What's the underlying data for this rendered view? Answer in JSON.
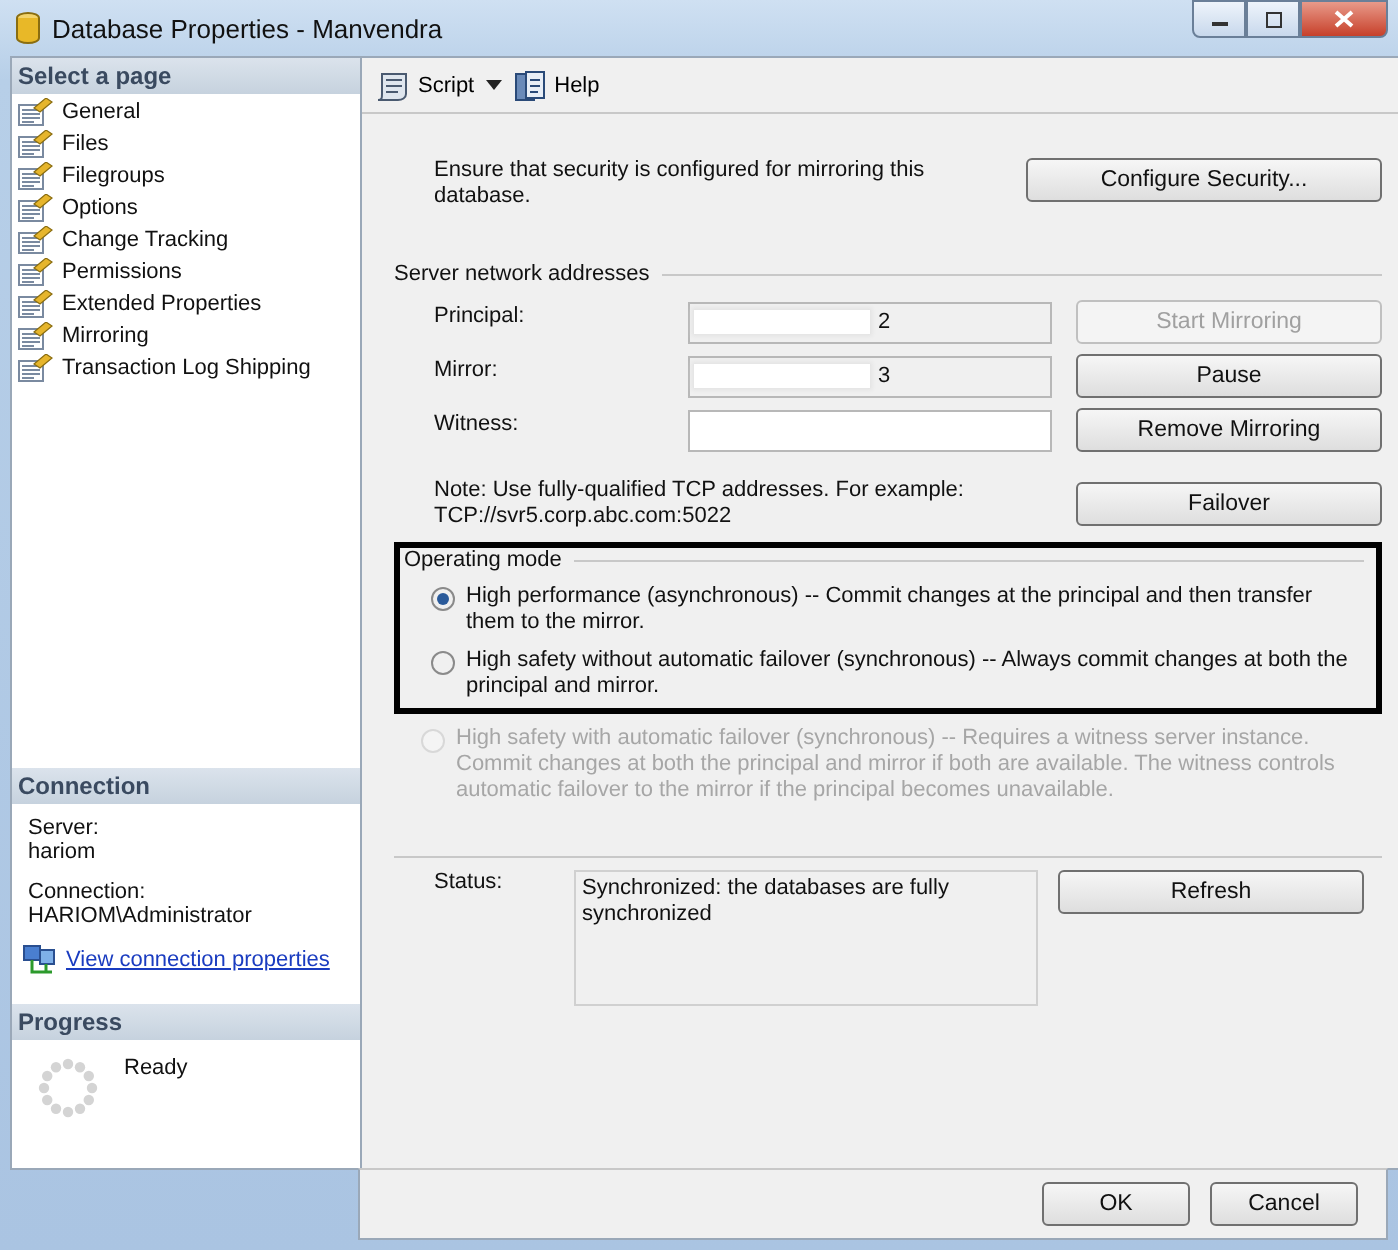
{
  "window": {
    "title": "Database Properties - Manvendra"
  },
  "sidebar": {
    "heading": "Select a page",
    "items": [
      {
        "label": "General"
      },
      {
        "label": "Files"
      },
      {
        "label": "Filegroups"
      },
      {
        "label": "Options"
      },
      {
        "label": "Change Tracking"
      },
      {
        "label": "Permissions"
      },
      {
        "label": "Extended Properties"
      },
      {
        "label": "Mirroring"
      },
      {
        "label": "Transaction Log Shipping"
      }
    ]
  },
  "connection": {
    "heading": "Connection",
    "server_label": "Server:",
    "server": "hariom",
    "connection_label": "Connection:",
    "connection": "HARIOM\\Administrator",
    "link": "View connection properties"
  },
  "progress": {
    "heading": "Progress",
    "status": "Ready"
  },
  "toolbar": {
    "script": "Script",
    "help": "Help"
  },
  "security": {
    "text": "Ensure that security is configured for mirroring this database.",
    "button": "Configure Security..."
  },
  "addresses": {
    "heading": "Server network addresses",
    "rows": [
      {
        "label": "Principal:",
        "value": "2",
        "redacted": true,
        "readonly": true,
        "button": {
          "label": "Start Mirroring",
          "disabled": true
        }
      },
      {
        "label": "Mirror:",
        "value": "3",
        "redacted": true,
        "readonly": true,
        "button": {
          "label": "Pause",
          "disabled": false
        }
      },
      {
        "label": "Witness:",
        "value": "",
        "redacted": false,
        "readonly": false,
        "button": {
          "label": "Remove Mirroring",
          "disabled": false
        }
      }
    ],
    "note": "Note: Use fully-qualified TCP addresses. For example: TCP://svr5.corp.abc.com:5022",
    "note_button": "Failover"
  },
  "operating_mode": {
    "heading": "Operating mode",
    "options": [
      {
        "label": "High performance (asynchronous) -- Commit changes at the principal and then transfer them to the mirror.",
        "selected": true,
        "disabled": false
      },
      {
        "label": "High safety without automatic failover (synchronous) -- Always commit changes at both the principal and mirror.",
        "selected": false,
        "disabled": false
      },
      {
        "label": "High safety with automatic failover (synchronous) -- Requires a witness server instance. Commit changes at both the principal and mirror if both are available. The witness controls automatic failover to the mirror if the principal becomes unavailable.",
        "selected": false,
        "disabled": true
      }
    ]
  },
  "status": {
    "label": "Status:",
    "value": "Synchronized: the databases are fully synchronized",
    "button": "Refresh"
  },
  "buttons": [
    "OK",
    "Cancel"
  ]
}
